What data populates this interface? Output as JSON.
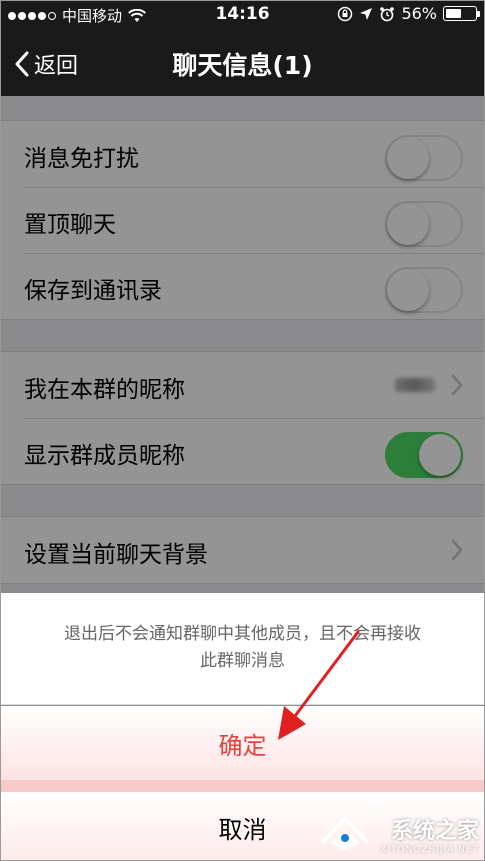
{
  "status_bar": {
    "carrier": "中国移动",
    "time": "14:16",
    "battery": "56%",
    "battery_level": 0.56
  },
  "nav": {
    "back_label": "返回",
    "title": "聊天信息(1)"
  },
  "settings": {
    "group1": [
      {
        "label": "消息免打扰",
        "toggle": false
      },
      {
        "label": "置顶聊天",
        "toggle": false
      },
      {
        "label": "保存到通讯录",
        "toggle": false
      }
    ],
    "group2": [
      {
        "label": "我在本群的昵称"
      },
      {
        "label": "显示群成员昵称",
        "toggle": true
      }
    ],
    "group3": [
      {
        "label": "设置当前聊天背景"
      }
    ]
  },
  "action_sheet": {
    "message_line1": "退出后不会通知群聊中其他成员，且不会再接收",
    "message_line2": "此群聊消息",
    "confirm_label": "确定",
    "cancel_label": "取消"
  },
  "watermark": {
    "text_cn": "系统之家",
    "text_en": "XITONGZHIJIA.NET"
  },
  "colors": {
    "confirm": "#e64340",
    "toggle_on": "#4cd964",
    "arrow": "#e02020"
  }
}
